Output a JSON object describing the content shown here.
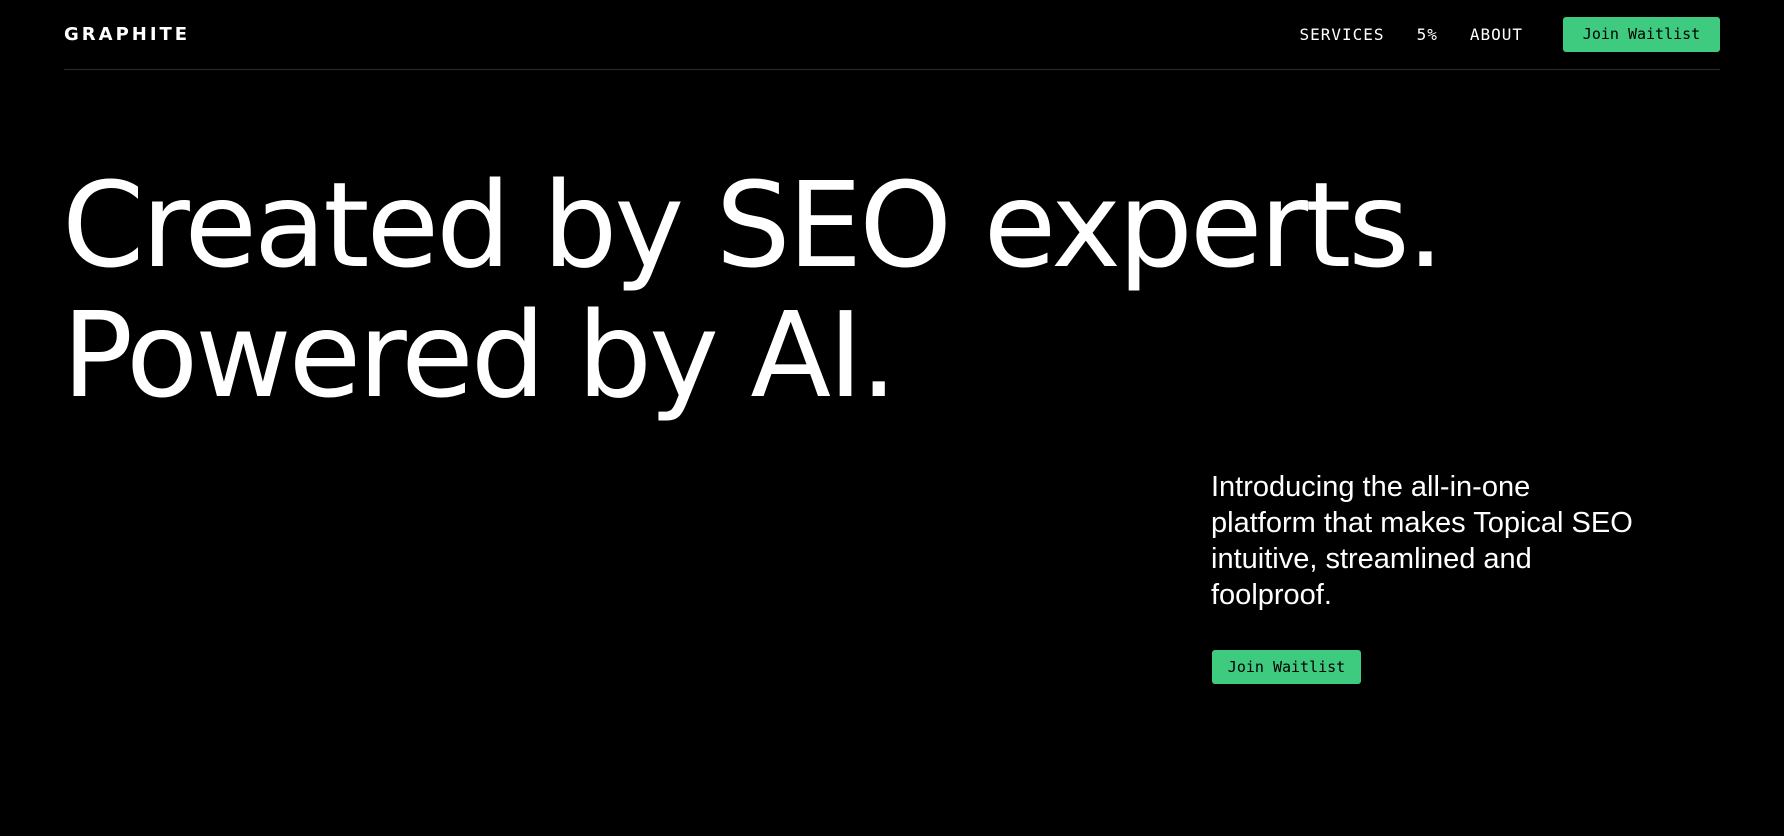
{
  "header": {
    "logo": "GRAPHITE",
    "nav": [
      {
        "label": "SERVICES"
      },
      {
        "label": "5%"
      },
      {
        "label": "ABOUT"
      }
    ],
    "cta_label": "Join Waitlist"
  },
  "hero": {
    "headline_line1": "Created by SEO experts.",
    "headline_line2": "Powered by AI.",
    "intro": "Introducing the all-in-one platform that makes Topical SEO intuitive, streamlined and foolproof.",
    "cta_label": "Join Waitlist"
  },
  "colors": {
    "background": "#000000",
    "text": "#ffffff",
    "accent": "#3ecb80"
  }
}
